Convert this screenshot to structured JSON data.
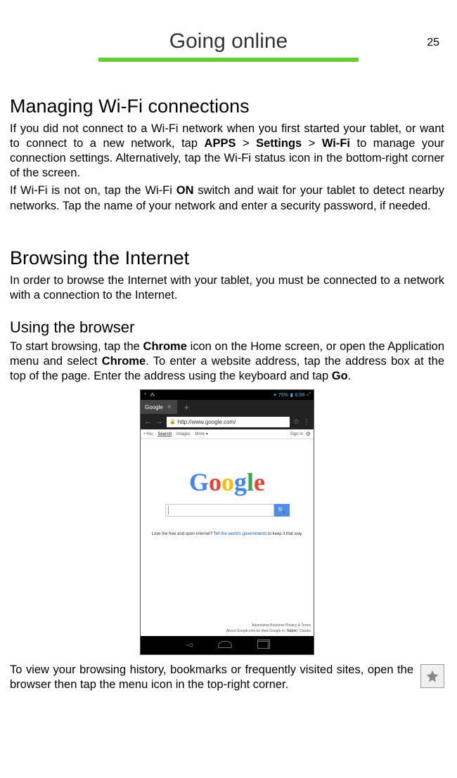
{
  "page_number": "25",
  "title": "Going online",
  "h1_1": "Managing Wi-Fi connections",
  "p1_pre": "If you did not connect to a Wi-Fi network when you first started your tablet, or want to connect to a new network, tap ",
  "p1_b1": "APPS",
  "p1_gt1": " > ",
  "p1_b2": "Settings",
  "p1_gt2": " > ",
  "p1_b3": "Wi-Fi",
  "p1_post": " to manage your connection settings. Alternatively, tap the Wi-Fi status icon in the bottom-right corner of the screen.",
  "p2_pre": "If Wi-Fi is not on, tap the Wi-Fi ",
  "p2_b1": "ON",
  "p2_post": " switch and wait for your tablet to detect nearby networks. Tap the name of your network and enter a security password, if needed.",
  "h1_2": "Browsing the Internet",
  "p3": "In order to browse the Internet with your tablet, you must be connected to a network with a connection to the Internet.",
  "h2_1": "Using the browser",
  "p4_pre": "To start browsing, tap the ",
  "p4_b1": "Chrome",
  "p4_mid1": " icon on the Home screen, or open the Application menu and select ",
  "p4_b2": "Chrome",
  "p4_mid2": ". To enter a website address, tap the address box at the top of the page. Enter the address using the keyboard and tap ",
  "p4_b3": "Go",
  "p4_post": ".",
  "screenshot": {
    "battery": "75%",
    "time": "6:59",
    "tab_title": "Google",
    "url": "http://www.google.com/",
    "nav_left": {
      "you": "+You",
      "search": "Search",
      "images": "Images",
      "more": "More ▾"
    },
    "nav_right": {
      "signin": "Sign in"
    },
    "logo": {
      "c1": "G",
      "c2": "o",
      "c3": "o",
      "c4": "g",
      "c5": "l",
      "c6": "e"
    },
    "tagline_pre": "Love the free and open internet? ",
    "tagline_link": "Tell the world's governments",
    "tagline_post": " to keep it that way.",
    "footer_line1": "Advertising      Business      Privacy & Terms",
    "footer_line2_pre": "About      Google.com.tw      View Google in: ",
    "footer_line2_bold": "Tablet",
    "footer_line2_post": " | Classic"
  },
  "p5": "To view your browsing history, bookmarks or frequently visited sites, open the browser then tap the menu icon in the top-right corner."
}
